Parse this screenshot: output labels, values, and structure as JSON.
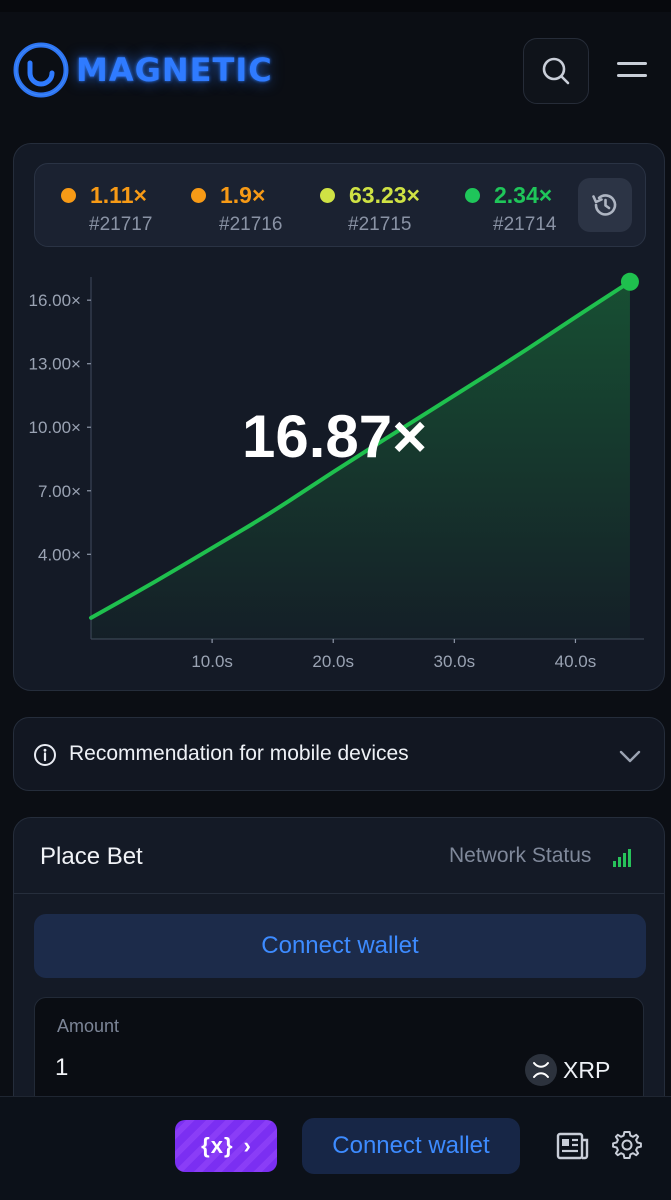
{
  "app": {
    "logo_text": "MAGNETIC",
    "brand_color": "#2f7bff"
  },
  "header": {
    "search_icon": "search-icon",
    "menu_icon": "hamburger-menu-icon"
  },
  "history": {
    "items": [
      {
        "multiplier": "1.11×",
        "round": "#21717",
        "color": "#f79a16"
      },
      {
        "multiplier": "1.9×",
        "round": "#21716",
        "color": "#f79a16"
      },
      {
        "multiplier": "63.23×",
        "round": "#21715",
        "color": "#cfe244"
      },
      {
        "multiplier": "2.34×",
        "round": "#21714",
        "color": "#1fc65a"
      }
    ],
    "history_icon": "history-icon"
  },
  "game": {
    "current_multiplier": "16.87×",
    "curve_color": "#1fc04e"
  },
  "chart_data": {
    "type": "area",
    "x_unit": "s",
    "y_unit": "×",
    "x_ticks": [
      "10.0s",
      "20.0s",
      "30.0s",
      "40.0s"
    ],
    "y_ticks": [
      "4.00×",
      "7.00×",
      "10.00×",
      "13.00×",
      "16.00×"
    ],
    "xlim": [
      0,
      45
    ],
    "ylim": [
      0,
      17
    ],
    "series": [
      {
        "x": [
          0,
          5,
          10,
          15,
          20,
          25,
          30,
          35,
          40,
          44.5
        ],
        "y": [
          1.0,
          2.6,
          4.3,
          6.0,
          7.9,
          9.7,
          11.5,
          13.3,
          15.2,
          16.87
        ]
      }
    ],
    "grid": false
  },
  "recommendation": {
    "text": "Recommendation for mobile devices"
  },
  "bet": {
    "title": "Place Bet",
    "network_status": "Network Status",
    "connect_label": "Connect wallet",
    "amount_label": "Amount",
    "amount_value": "1",
    "currency": "XRP"
  },
  "bottom_bar": {
    "promo_label": "{x}",
    "connect_label": "Connect wallet"
  }
}
